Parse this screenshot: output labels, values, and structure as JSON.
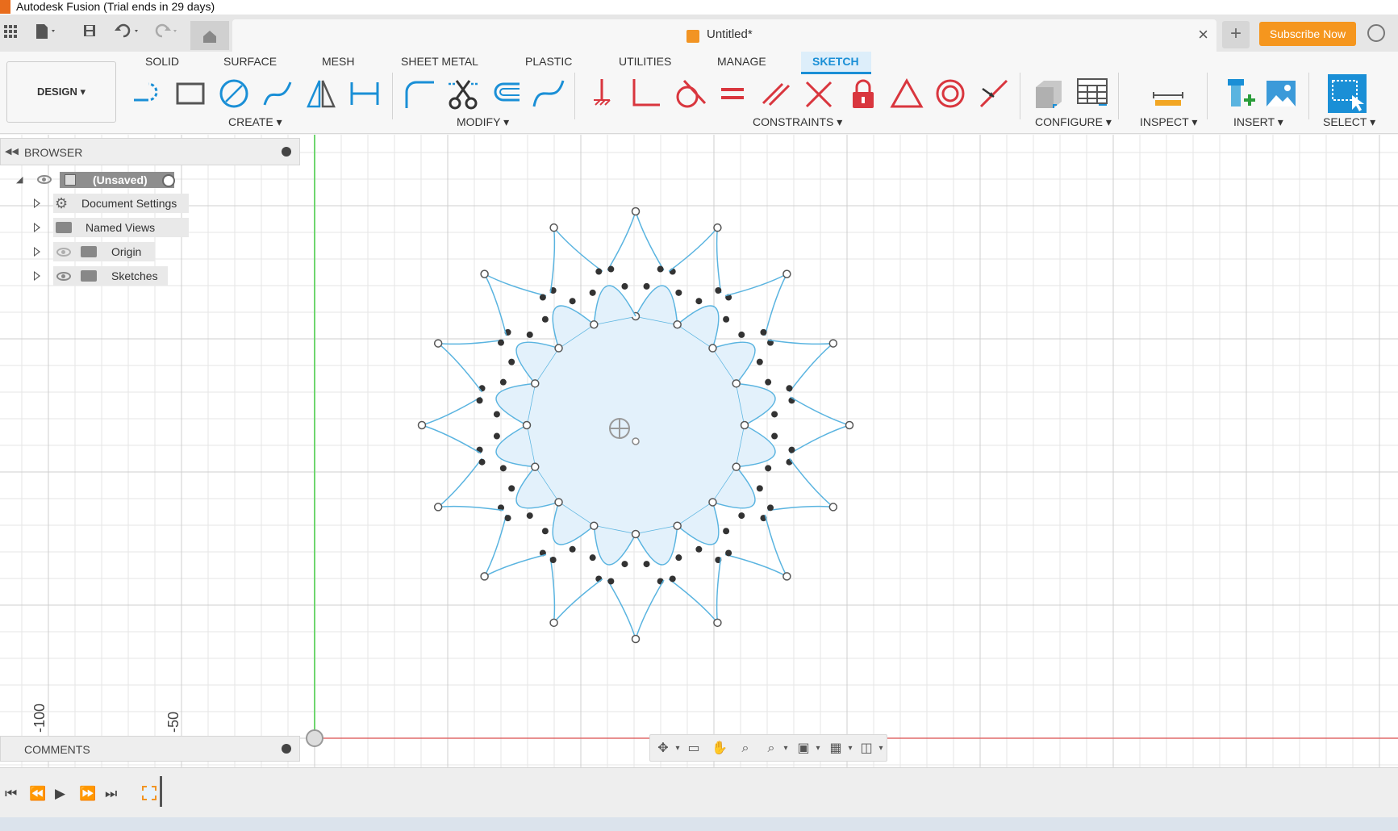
{
  "window": {
    "title": "Autodesk Fusion (Trial ends in 29 days)"
  },
  "topbar": {
    "doc_name": "Untitled*",
    "subscribe_label": "Subscribe Now",
    "icons": [
      "apps-grid-icon",
      "file-icon",
      "save-icon",
      "undo-icon",
      "redo-icon",
      "home-icon",
      "close-icon",
      "new-tab-icon",
      "account-icon"
    ]
  },
  "ribbon": {
    "workspace_label": "DESIGN",
    "tabs": [
      "SOLID",
      "SURFACE",
      "MESH",
      "SHEET METAL",
      "PLASTIC",
      "UTILITIES",
      "MANAGE",
      "SKETCH"
    ],
    "active_tab": "SKETCH",
    "groups": [
      "CREATE",
      "MODIFY",
      "CONSTRAINTS",
      "CONFIGURE",
      "INSPECT",
      "INSERT",
      "SELECT"
    ],
    "accent_color": "#1a8fd6"
  },
  "browser": {
    "title": "BROWSER",
    "root": "(Unsaved)",
    "items": [
      "Document Settings",
      "Named Views",
      "Origin",
      "Sketches"
    ]
  },
  "comments": {
    "title": "COMMENTS"
  },
  "canvas": {
    "ruler_labels": [
      "-100",
      "-50"
    ],
    "sketch_color": "#5ab4e0",
    "fill_color": "#e3f1fb"
  },
  "timeline": {
    "controls": [
      "first-frame",
      "previous-frame",
      "play",
      "next-frame",
      "last-frame"
    ]
  }
}
